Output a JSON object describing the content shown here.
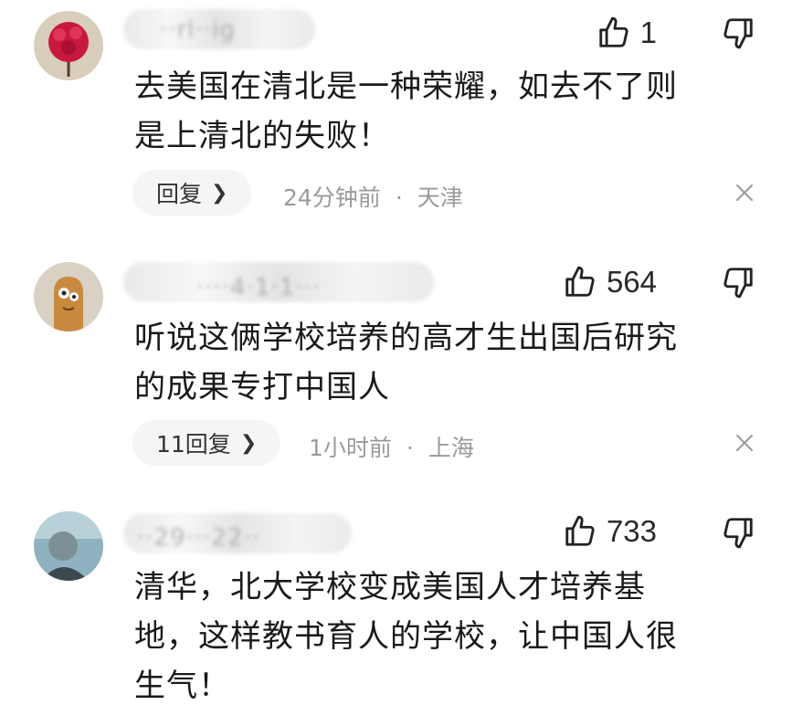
{
  "colors": {
    "text": "#1a1a1a",
    "muted": "#9a9a9a",
    "reply_bg": "#f5f5f5"
  },
  "comments": [
    {
      "username": "··rl··ig",
      "likes": "1",
      "lines": [
        "去美国在清北是一种荣耀，如去不了则",
        "是上清北的失败！"
      ],
      "reply_label": "回复",
      "time": "24分钟前",
      "location": "天津"
    },
    {
      "username": "····4·1·1···",
      "likes": "564",
      "lines": [
        "听说这俩学校培养的高才生出国后研究",
        "的成果专打中国人"
      ],
      "reply_label": "11回复",
      "time": "1小时前",
      "location": "上海"
    },
    {
      "username": "··29···22··",
      "likes": "733",
      "lines": [
        "清华，北大学校变成美国人才培养基",
        "地，这样教书育人的学校，让中国人很",
        "生气！"
      ]
    }
  ],
  "icons": {
    "like": "thumbs-up-icon",
    "dislike": "thumbs-down-icon",
    "close": "close-icon",
    "reply_chevron": "chevron-right-icon"
  }
}
